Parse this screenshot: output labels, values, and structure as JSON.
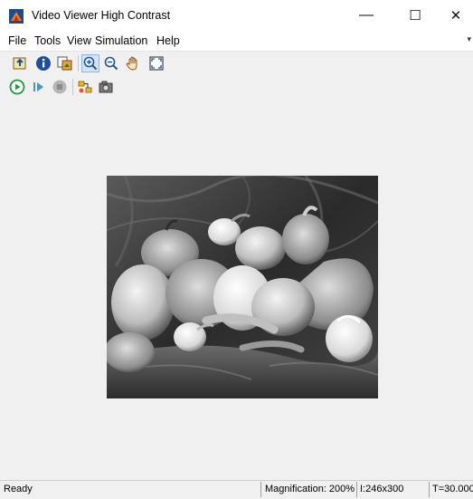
{
  "window": {
    "title": "Video Viewer High Contrast",
    "minimize_glyph": "—",
    "maximize_glyph": "☐",
    "close_glyph": "✕"
  },
  "menu": {
    "items": [
      "File",
      "Tools",
      "View",
      "Simulation",
      "Help"
    ],
    "pin_glyph": "▾"
  },
  "toolbar1": {
    "icons": [
      "parent-model-icon",
      "info-icon",
      "export-frame-icon",
      "zoom-in-icon",
      "zoom-out-icon",
      "pan-hand-icon",
      "fit-to-view-icon"
    ],
    "pressed": "zoom-in-icon"
  },
  "toolbar2": {
    "icons": [
      "run-icon",
      "step-forward-icon",
      "stop-icon",
      "highlight-signal-icon",
      "snapshot-icon"
    ]
  },
  "status": {
    "ready": "Ready",
    "magnification": "Magnification: 200%",
    "image_size": "I:246x300",
    "time": "T=30.000"
  },
  "colors": {
    "titlebar_bg": "#ffffff",
    "window_bg": "#f0f0f0",
    "run_green": "#1a9c3a",
    "info_blue": "#1f4f9b"
  }
}
